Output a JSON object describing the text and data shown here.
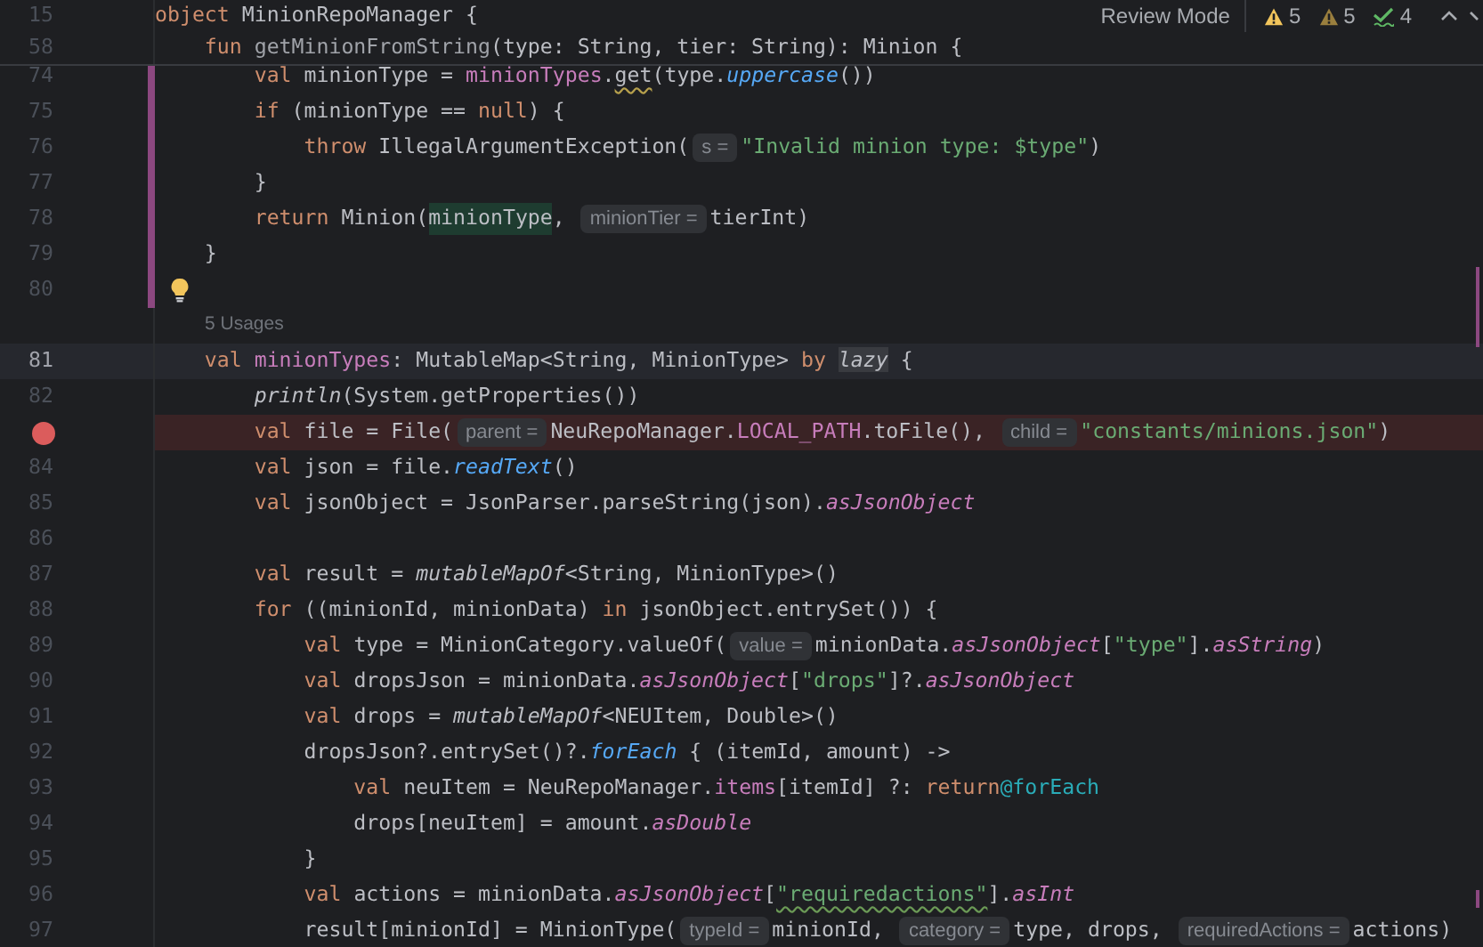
{
  "toolbar": {
    "mode_label": "Review Mode",
    "counters": [
      {
        "kind": "warning",
        "count": "5"
      },
      {
        "kind": "weak_warning",
        "count": "5"
      },
      {
        "kind": "typo",
        "count": "4"
      }
    ]
  },
  "sticky_lines": [
    {
      "number": "15",
      "tokens": [
        {
          "kind": "keyword",
          "text": "object "
        },
        {
          "kind": "plain",
          "text": "MinionRepoManager {"
        }
      ]
    },
    {
      "number": "58",
      "tokens": [
        {
          "kind": "keyword",
          "text": "    fun "
        },
        {
          "kind": "decl",
          "text": "getMinionFromString"
        },
        {
          "kind": "plain",
          "text": "(type: String, tier: String): Minion {"
        }
      ]
    }
  ],
  "lines": [
    {
      "kind": "code",
      "number": "74",
      "changed": true,
      "current": false,
      "breakpoint": false,
      "bulb": false,
      "tokens": [
        {
          "kind": "keyword",
          "text": "        val "
        },
        {
          "kind": "plain",
          "text": "minionType = "
        },
        {
          "kind": "prop",
          "text": "minionTypes"
        },
        {
          "kind": "plain",
          "text": "."
        },
        {
          "kind": "warn",
          "text": "get"
        },
        {
          "kind": "plain",
          "text": "(type."
        },
        {
          "kind": "ext",
          "text": "uppercase"
        },
        {
          "kind": "plain",
          "text": "())"
        }
      ]
    },
    {
      "kind": "code",
      "number": "75",
      "changed": true,
      "current": false,
      "breakpoint": false,
      "bulb": false,
      "tokens": [
        {
          "kind": "keyword",
          "text": "        if "
        },
        {
          "kind": "plain",
          "text": "(minionType == "
        },
        {
          "kind": "keyword",
          "text": "null"
        },
        {
          "kind": "plain",
          "text": ") {"
        }
      ]
    },
    {
      "kind": "code",
      "number": "76",
      "changed": true,
      "current": false,
      "breakpoint": false,
      "bulb": false,
      "tokens": [
        {
          "kind": "keyword",
          "text": "            throw "
        },
        {
          "kind": "plain",
          "text": "IllegalArgumentException("
        },
        {
          "kind": "hint",
          "text": "s ="
        },
        {
          "kind": "string",
          "text": "\"Invalid minion type: $type\""
        },
        {
          "kind": "plain",
          "text": ")"
        }
      ]
    },
    {
      "kind": "code",
      "number": "77",
      "changed": true,
      "current": false,
      "breakpoint": false,
      "bulb": false,
      "tokens": [
        {
          "kind": "plain",
          "text": "        }"
        }
      ]
    },
    {
      "kind": "code",
      "number": "78",
      "changed": true,
      "current": false,
      "breakpoint": false,
      "bulb": false,
      "tokens": [
        {
          "kind": "keyword",
          "text": "        return "
        },
        {
          "kind": "plain",
          "text": "Minion("
        },
        {
          "kind": "match",
          "text": "minionType"
        },
        {
          "kind": "plain",
          "text": ", "
        },
        {
          "kind": "hint",
          "text": "minionTier ="
        },
        {
          "kind": "plain",
          "text": "tierInt)"
        }
      ]
    },
    {
      "kind": "code",
      "number": "79",
      "changed": true,
      "current": false,
      "breakpoint": false,
      "bulb": false,
      "tokens": [
        {
          "kind": "plain",
          "text": "    }"
        }
      ]
    },
    {
      "kind": "code",
      "number": "80",
      "changed": true,
      "current": false,
      "breakpoint": false,
      "bulb": true
    },
    {
      "kind": "usages",
      "text": "5 Usages"
    },
    {
      "kind": "code",
      "number": "81",
      "changed": false,
      "current": true,
      "breakpoint": false,
      "bulb": false,
      "tokens": [
        {
          "kind": "keyword",
          "text": "    val "
        },
        {
          "kind": "prop",
          "text": "minionTypes"
        },
        {
          "kind": "plain",
          "text": ": MutableMap<String, MinionType> "
        },
        {
          "kind": "keyword",
          "text": "by "
        },
        {
          "kind": "marked_italic",
          "text": "lazy"
        },
        {
          "kind": "plain",
          "text": " {"
        }
      ]
    },
    {
      "kind": "code",
      "number": "82",
      "changed": false,
      "current": false,
      "breakpoint": false,
      "bulb": false,
      "tokens": [
        {
          "kind": "italic",
          "text": "        println"
        },
        {
          "kind": "plain",
          "text": "(System.getProperties())"
        }
      ]
    },
    {
      "kind": "code",
      "changed": false,
      "current": false,
      "breakpoint": true,
      "bulb": false,
      "tokens": [
        {
          "kind": "keyword",
          "text": "        val "
        },
        {
          "kind": "plain",
          "text": "file = File("
        },
        {
          "kind": "hint",
          "text": "parent ="
        },
        {
          "kind": "plain",
          "text": "NeuRepoManager."
        },
        {
          "kind": "prop",
          "text": "LOCAL_PATH"
        },
        {
          "kind": "plain",
          "text": ".toFile(), "
        },
        {
          "kind": "hint",
          "text": "child ="
        },
        {
          "kind": "string",
          "text": "\"constants/minions.json\""
        },
        {
          "kind": "plain",
          "text": ")"
        }
      ]
    },
    {
      "kind": "code",
      "number": "84",
      "changed": false,
      "current": false,
      "breakpoint": false,
      "bulb": false,
      "tokens": [
        {
          "kind": "keyword",
          "text": "        val "
        },
        {
          "kind": "plain",
          "text": "json = file."
        },
        {
          "kind": "ext",
          "text": "readText"
        },
        {
          "kind": "plain",
          "text": "()"
        }
      ]
    },
    {
      "kind": "code",
      "number": "85",
      "changed": false,
      "current": false,
      "breakpoint": false,
      "bulb": false,
      "tokens": [
        {
          "kind": "keyword",
          "text": "        val "
        },
        {
          "kind": "plain",
          "text": "jsonObject = JsonParser.parseString(json)."
        },
        {
          "kind": "ext_prop",
          "text": "asJsonObject"
        }
      ]
    },
    {
      "kind": "code",
      "number": "86",
      "changed": false,
      "current": false,
      "breakpoint": false,
      "bulb": false
    },
    {
      "kind": "code",
      "number": "87",
      "changed": false,
      "current": false,
      "breakpoint": false,
      "bulb": false,
      "tokens": [
        {
          "kind": "keyword",
          "text": "        val "
        },
        {
          "kind": "plain",
          "text": "result = "
        },
        {
          "kind": "italic",
          "text": "mutableMapOf"
        },
        {
          "kind": "plain",
          "text": "<String, MinionType>()"
        }
      ]
    },
    {
      "kind": "code",
      "number": "88",
      "changed": false,
      "current": false,
      "breakpoint": false,
      "bulb": false,
      "tokens": [
        {
          "kind": "keyword",
          "text": "        for "
        },
        {
          "kind": "plain",
          "text": "((minionId, minionData) "
        },
        {
          "kind": "keyword",
          "text": "in "
        },
        {
          "kind": "plain",
          "text": "jsonObject.entrySet()) {"
        }
      ]
    },
    {
      "kind": "code",
      "number": "89",
      "changed": false,
      "current": false,
      "breakpoint": false,
      "bulb": false,
      "tokens": [
        {
          "kind": "keyword",
          "text": "            val "
        },
        {
          "kind": "plain",
          "text": "type = MinionCategory.valueOf("
        },
        {
          "kind": "hint",
          "text": "value ="
        },
        {
          "kind": "plain",
          "text": "minionData."
        },
        {
          "kind": "ext_prop",
          "text": "asJsonObject"
        },
        {
          "kind": "plain",
          "text": "["
        },
        {
          "kind": "string",
          "text": "\"type\""
        },
        {
          "kind": "plain",
          "text": "]."
        },
        {
          "kind": "ext_prop",
          "text": "asString"
        },
        {
          "kind": "plain",
          "text": ")"
        }
      ]
    },
    {
      "kind": "code",
      "number": "90",
      "changed": false,
      "current": false,
      "breakpoint": false,
      "bulb": false,
      "tokens": [
        {
          "kind": "keyword",
          "text": "            val "
        },
        {
          "kind": "plain",
          "text": "dropsJson = minionData."
        },
        {
          "kind": "ext_prop",
          "text": "asJsonObject"
        },
        {
          "kind": "plain",
          "text": "["
        },
        {
          "kind": "string",
          "text": "\"drops\""
        },
        {
          "kind": "plain",
          "text": "]?."
        },
        {
          "kind": "ext_prop",
          "text": "asJsonObject"
        }
      ]
    },
    {
      "kind": "code",
      "number": "91",
      "changed": false,
      "current": false,
      "breakpoint": false,
      "bulb": false,
      "tokens": [
        {
          "kind": "keyword",
          "text": "            val "
        },
        {
          "kind": "plain",
          "text": "drops = "
        },
        {
          "kind": "italic",
          "text": "mutableMapOf"
        },
        {
          "kind": "plain",
          "text": "<NEUItem, Double>()"
        }
      ]
    },
    {
      "kind": "code",
      "number": "92",
      "changed": false,
      "current": false,
      "breakpoint": false,
      "bulb": false,
      "tokens": [
        {
          "kind": "plain",
          "text": "            dropsJson?.entrySet()?."
        },
        {
          "kind": "ext",
          "text": "forEach"
        },
        {
          "kind": "plain",
          "text": " { (itemId, amount) ->"
        }
      ]
    },
    {
      "kind": "code",
      "number": "93",
      "changed": false,
      "current": false,
      "breakpoint": false,
      "bulb": false,
      "tokens": [
        {
          "kind": "keyword",
          "text": "                val "
        },
        {
          "kind": "plain",
          "text": "neuItem = NeuRepoManager."
        },
        {
          "kind": "prop",
          "text": "items"
        },
        {
          "kind": "plain",
          "text": "[itemId] ?: "
        },
        {
          "kind": "keyword",
          "text": "return"
        },
        {
          "kind": "label",
          "text": "@forEach"
        }
      ]
    },
    {
      "kind": "code",
      "number": "94",
      "changed": false,
      "current": false,
      "breakpoint": false,
      "bulb": false,
      "tokens": [
        {
          "kind": "plain",
          "text": "                drops[neuItem] = amount."
        },
        {
          "kind": "ext_prop",
          "text": "asDouble"
        }
      ]
    },
    {
      "kind": "code",
      "number": "95",
      "changed": false,
      "current": false,
      "breakpoint": false,
      "bulb": false,
      "tokens": [
        {
          "kind": "plain",
          "text": "            }"
        }
      ]
    },
    {
      "kind": "code",
      "number": "96",
      "changed": false,
      "current": false,
      "breakpoint": false,
      "bulb": false,
      "tokens": [
        {
          "kind": "keyword",
          "text": "            val "
        },
        {
          "kind": "plain",
          "text": "actions = minionData."
        },
        {
          "kind": "ext_prop",
          "text": "asJsonObject"
        },
        {
          "kind": "plain",
          "text": "["
        },
        {
          "kind": "typo_string",
          "text": "\"requiredactions\""
        },
        {
          "kind": "plain",
          "text": "]."
        },
        {
          "kind": "ext_prop",
          "text": "asInt"
        }
      ]
    },
    {
      "kind": "code",
      "number": "97",
      "changed": false,
      "current": false,
      "breakpoint": false,
      "bulb": false,
      "tokens": [
        {
          "kind": "plain",
          "text": "            result[minionId] = MinionType("
        },
        {
          "kind": "hint",
          "text": "typeId ="
        },
        {
          "kind": "plain",
          "text": "minionId, "
        },
        {
          "kind": "hint",
          "text": "category ="
        },
        {
          "kind": "plain",
          "text": "type, drops, "
        },
        {
          "kind": "hint",
          "text": "requiredActions ="
        },
        {
          "kind": "plain",
          "text": "actions)"
        }
      ]
    }
  ]
}
